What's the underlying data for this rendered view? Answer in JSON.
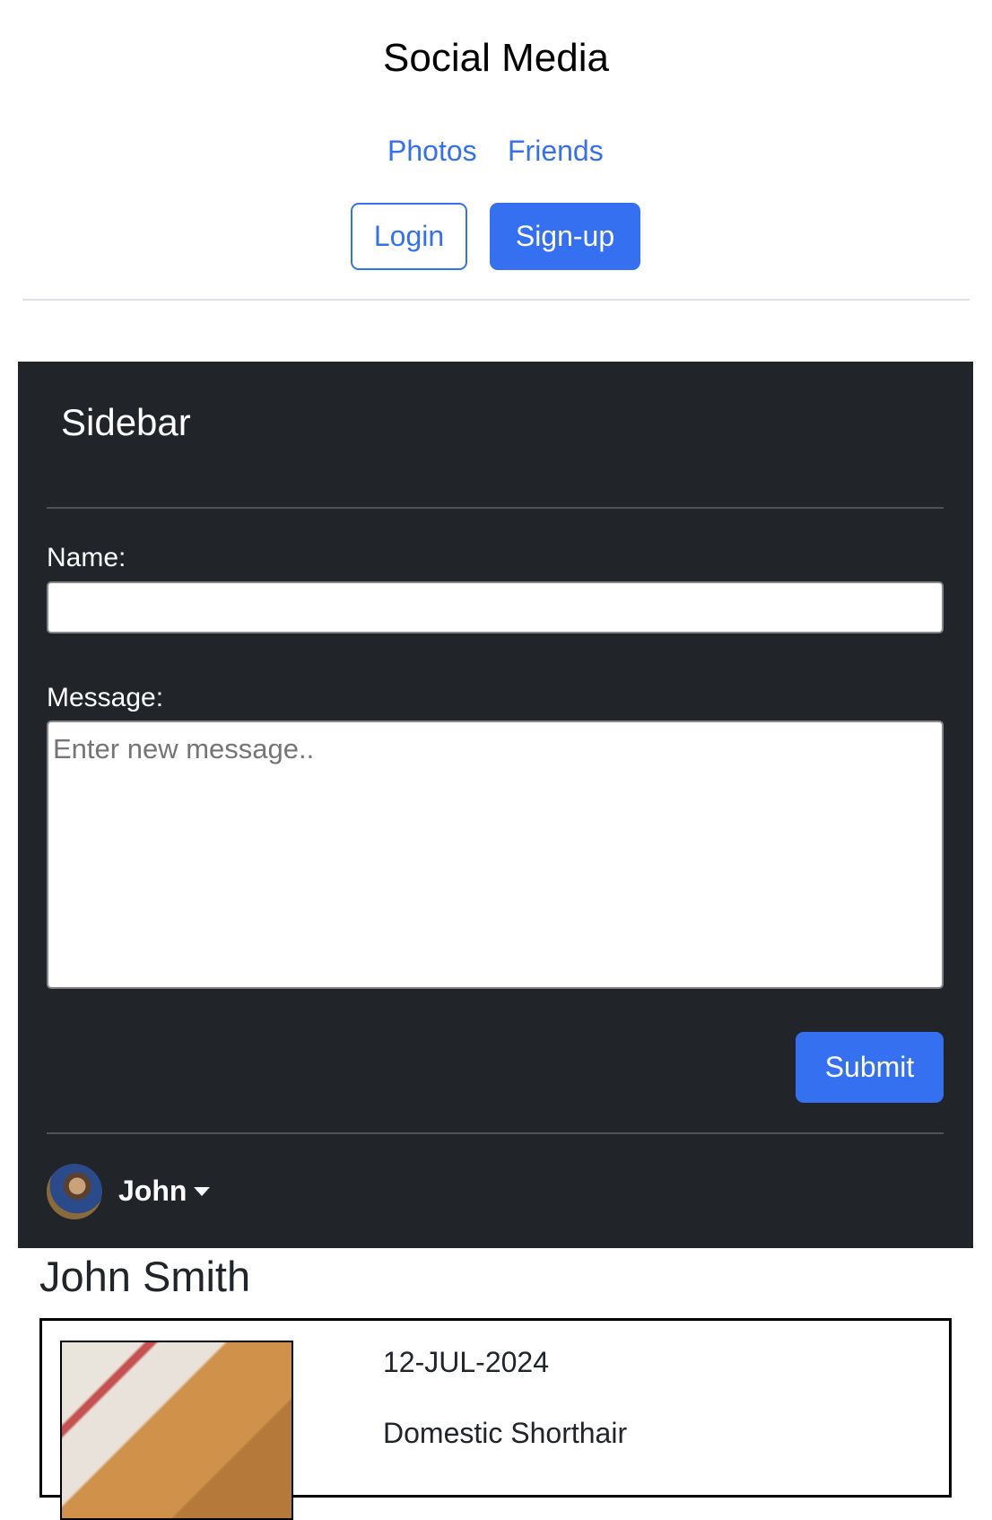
{
  "header": {
    "title": "Social Media",
    "nav": [
      "Photos",
      "Friends"
    ],
    "login": "Login",
    "signup": "Sign-up"
  },
  "sidebar": {
    "title": "Sidebar",
    "name_label": "Name:",
    "name_value": "",
    "message_label": "Message:",
    "message_placeholder": "Enter new message..",
    "submit": "Submit",
    "user": "John"
  },
  "profile": {
    "name": "John Smith",
    "post": {
      "date": "12-JUL-2024",
      "breed": "Domestic Shorthair"
    }
  },
  "colors": {
    "accent": "#3470f0",
    "sidebar_bg": "#212529"
  }
}
